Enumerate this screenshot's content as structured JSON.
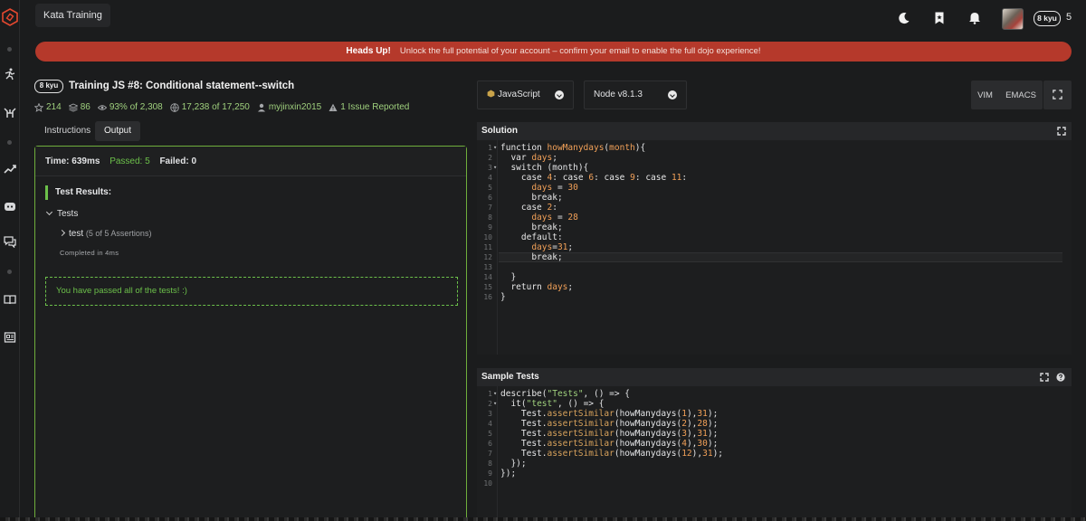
{
  "topbar": {
    "kata_training": "Kata Training",
    "rank": "8 kyu",
    "honor": "5"
  },
  "banner": {
    "heads_up": "Heads Up!",
    "message": "Unlock the full potential of your account – confirm your email to enable the full dojo experience!"
  },
  "kata": {
    "kyu": "8 kyu",
    "title": "Training JS #8: Conditional statement--switch",
    "stars": "214",
    "collections": "86",
    "satisfaction": "93% of 2,308",
    "completed": "17,238 of 17,250",
    "author": "myjinxin2015",
    "issues": "1 Issue Reported"
  },
  "tabs": {
    "instructions": "Instructions",
    "output": "Output"
  },
  "output": {
    "time": "Time: 639ms",
    "passed": "Passed: 5",
    "failed": "Failed: 0",
    "test_results": "Test Results:",
    "tests_group": "Tests",
    "test_name": "test",
    "assertions": "(5 of 5 Assertions)",
    "completed_in": "Completed in 4ms",
    "all_passed": "You have passed all of the tests! :)"
  },
  "editor": {
    "language": "JavaScript",
    "runtime": "Node v8.1.3",
    "vim": "VIM",
    "emacs": "EMACS",
    "solution_title": "Solution",
    "sample_tests_title": "Sample Tests"
  },
  "solution_lines": [
    "1",
    "2",
    "3",
    "4",
    "5",
    "6",
    "7",
    "8",
    "9",
    "10",
    "11",
    "12",
    "13",
    "14",
    "15",
    "16"
  ],
  "test_lines": [
    "1",
    "2",
    "3",
    "4",
    "5",
    "6",
    "7",
    "8",
    "9",
    "10"
  ],
  "icons": {
    "logo": "codewars-logo",
    "theme": "moon-icon",
    "bookmark": "bookmark-icon",
    "notifications": "bell-icon"
  },
  "colors": {
    "brand": "#b5392b",
    "pass": "#6cc04a"
  }
}
